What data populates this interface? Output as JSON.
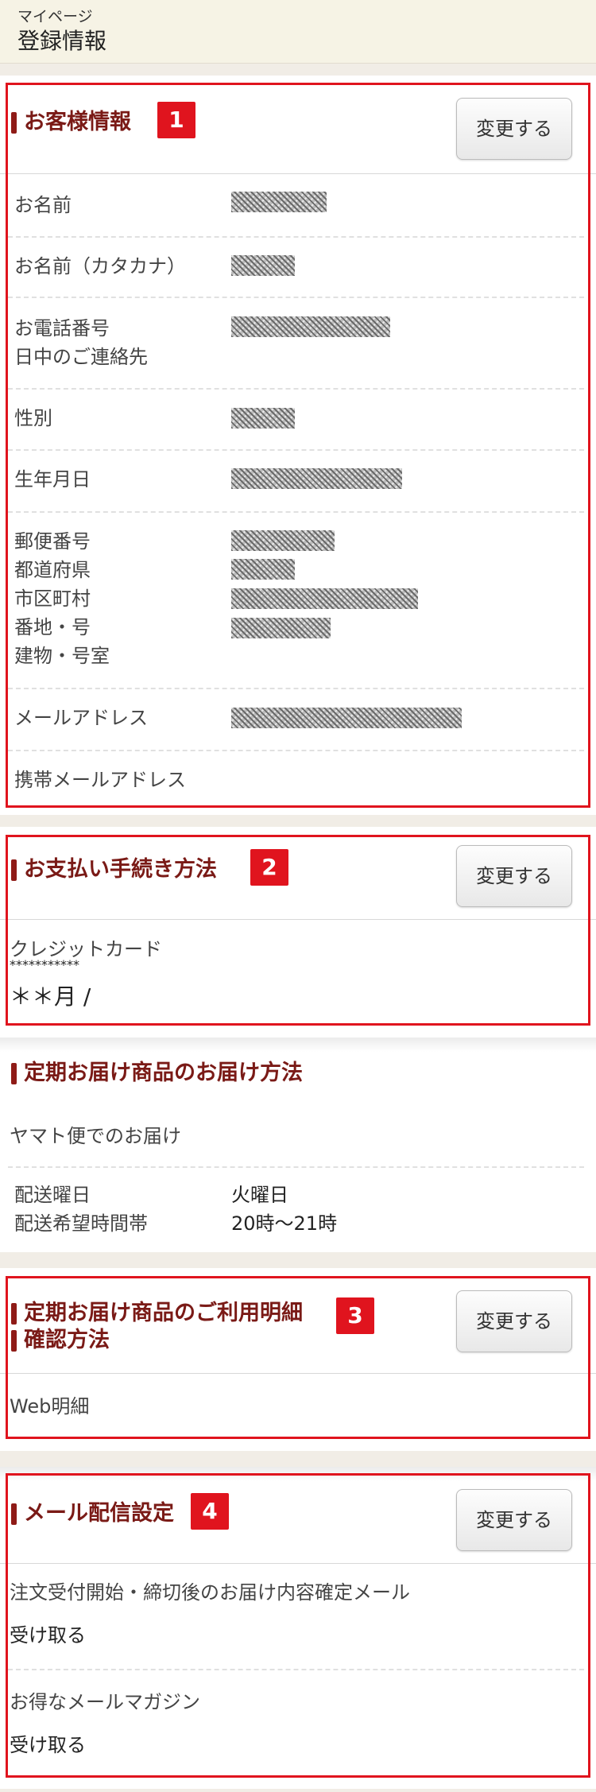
{
  "header": {
    "breadcrumb": "マイページ",
    "title": "登録情報"
  },
  "customer": {
    "title": "お客様情報",
    "badge": "1",
    "change": "変更する",
    "rows": {
      "name": "お名前",
      "kana": "お名前（カタカナ）",
      "phone": "お電話番号\n日中のご連絡先",
      "gender": "性別",
      "birthday": "生年月日",
      "address": "郵便番号\n都道府県\n市区町村\n番地・号\n建物・号室",
      "email": "メールアドレス",
      "mobile_email": "携帯メールアドレス"
    }
  },
  "payment": {
    "title": "お支払い手続き方法",
    "badge": "2",
    "change": "変更する",
    "method": "クレジットカード",
    "card_number": "***********",
    "expiry": "＊＊月 /"
  },
  "delivery": {
    "title": "定期お届け商品のお届け方法",
    "method": "ヤマト便でのお届け",
    "day_label": "配送曜日",
    "day_value": "火曜日",
    "time_label": "配送希望時間帯",
    "time_value": "20時〜21時"
  },
  "statement": {
    "title_line1": "定期お届け商品のご利用明細",
    "title_line2": "確認方法",
    "badge": "3",
    "change": "変更する",
    "method": "Web明細"
  },
  "mail": {
    "title": "メール配信設定",
    "badge": "4",
    "change": "変更する",
    "items": [
      {
        "label": "注文受付開始・締切後のお届け内容確定メール",
        "value": "受け取る"
      },
      {
        "label": "お得なメールマガジン",
        "value": "受け取る"
      }
    ]
  }
}
